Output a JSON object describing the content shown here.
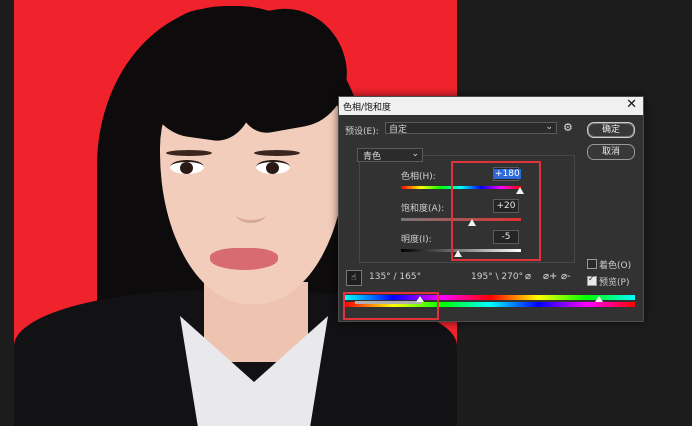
{
  "dialog": {
    "title": "色相/饱和度",
    "close": "✕",
    "preset_label": "预设(E):",
    "preset_value": "自定",
    "preset_chevron": "⌄",
    "gear": "⚙",
    "ok": "确定",
    "cancel": "取消",
    "channel": "青色",
    "channel_chevron": "⌄",
    "hue_label": "色相(H):",
    "hue_value": "+180",
    "saturation_label": "饱和度(A):",
    "saturation_value": "+20",
    "lightness_label": "明度(I):",
    "lightness_value": "-5",
    "colorize_label": "着色(O)",
    "colorize_checked": false,
    "preview_label": "预览(P)",
    "preview_checked": true,
    "range_left": "135° / 165°",
    "range_right": "195° \\ 270°",
    "hand_icon": "☝",
    "eyedropper_icons": [
      "⌀",
      "⌀+",
      "⌀-"
    ]
  },
  "colors": {
    "canvas_bg": "#f0232c",
    "highlight": "#e0323a",
    "selection": "#2f6bd6"
  }
}
